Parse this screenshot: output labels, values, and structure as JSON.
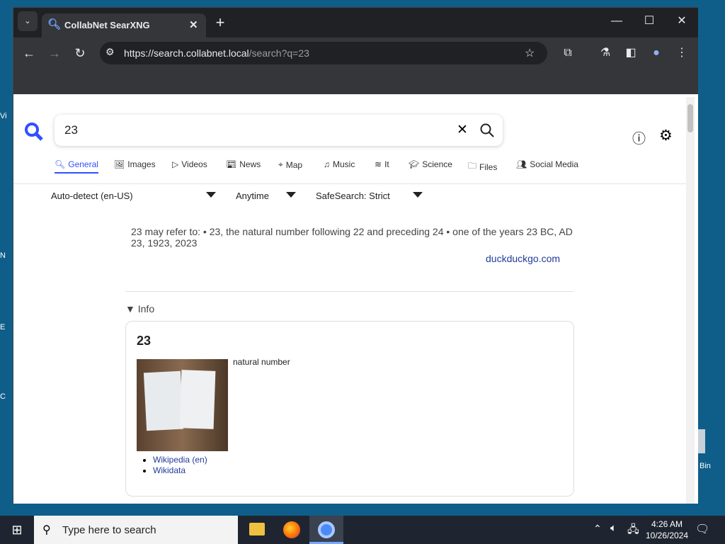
{
  "browser": {
    "tab_title": "CollabNet SearXNG",
    "url_host": "https://search.collabnet.local",
    "url_path": "/search?q=23"
  },
  "search": {
    "query": "23"
  },
  "categories": [
    "General",
    "Images",
    "Videos",
    "News",
    "Map",
    "Music",
    "It",
    "Science",
    "Files",
    "Social Media"
  ],
  "filters": {
    "language": "Auto-detect (en-US)",
    "time": "Anytime",
    "safesearch": "SafeSearch: Strict"
  },
  "answer": {
    "text": "23 may refer to: • 23, the natural number following 22 and preceding 24 • one of the years 23 BC, AD 23, 1923, 2023",
    "source": "duckduckgo.com"
  },
  "infobox": {
    "toggle": "Info",
    "title": "23",
    "description": "natural number",
    "links": [
      "Wikipedia (en)",
      "Wikidata"
    ]
  },
  "taskbar": {
    "search_placeholder": "Type here to search",
    "time": "4:26 AM",
    "date": "10/26/2024"
  },
  "desktop": {
    "icon_labels": [
      "Vi",
      "N",
      "E",
      "C"
    ],
    "bin_label": "Bin"
  }
}
